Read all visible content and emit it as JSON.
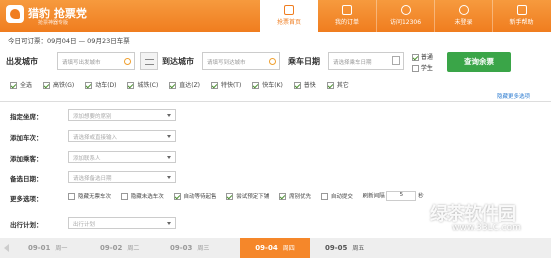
{
  "header": {
    "logo_title": "猎豹 抢票党",
    "logo_sub": "抢票神器专版",
    "nav": [
      "抢票首页",
      "我的订单",
      "访问12306",
      "未登录",
      "新手帮助"
    ]
  },
  "search": {
    "date_range": "今日可订票：09月04日 — 09月23日车票",
    "from_label": "出发城市",
    "from_placeholder": "请填写出发城市",
    "to_label": "到达城市",
    "to_placeholder": "请填写到达城市",
    "date_label": "乘车日期",
    "date_placeholder": "请选择乘车日期",
    "ticket_normal": "普通",
    "ticket_student": "学生",
    "query_button": "查询余票"
  },
  "filters": {
    "items": [
      "全选",
      "高铁(G)",
      "动车(D)",
      "城铁(C)",
      "直达(Z)",
      "特快(T)",
      "快车(K)",
      "普快",
      "其它"
    ],
    "more": "隐藏更多选项"
  },
  "form": {
    "seat_label": "指定坐席：",
    "seat_placeholder": "添加想要的席别",
    "train_label": "添加车次：",
    "train_placeholder": "请选择或直接输入",
    "passenger_label": "添加乘客：",
    "passenger_placeholder": "添加联系人",
    "backup_date_label": "备选日期：",
    "backup_date_placeholder": "请选择备选日期",
    "more_label": "更多选项：",
    "options": [
      "隐藏无票车次",
      "隐藏未选车次",
      "自动等待起售",
      "尝试预定下铺",
      "席别优先",
      "自动提交"
    ],
    "refresh_label": "刷新间隔",
    "refresh_value": "5",
    "refresh_unit": "秒",
    "plan_label": "出行计划：",
    "plan_placeholder": "出行计划"
  },
  "dates": [
    {
      "date": "09-01",
      "week": "周一"
    },
    {
      "date": "09-02",
      "week": "周二"
    },
    {
      "date": "09-03",
      "week": "周三"
    },
    {
      "date": "09-04",
      "week": "周四"
    },
    {
      "date": "09-05",
      "week": "周五"
    }
  ],
  "watermark": {
    "line1": "绿茶软件园",
    "line2": "www.33LC.com"
  }
}
